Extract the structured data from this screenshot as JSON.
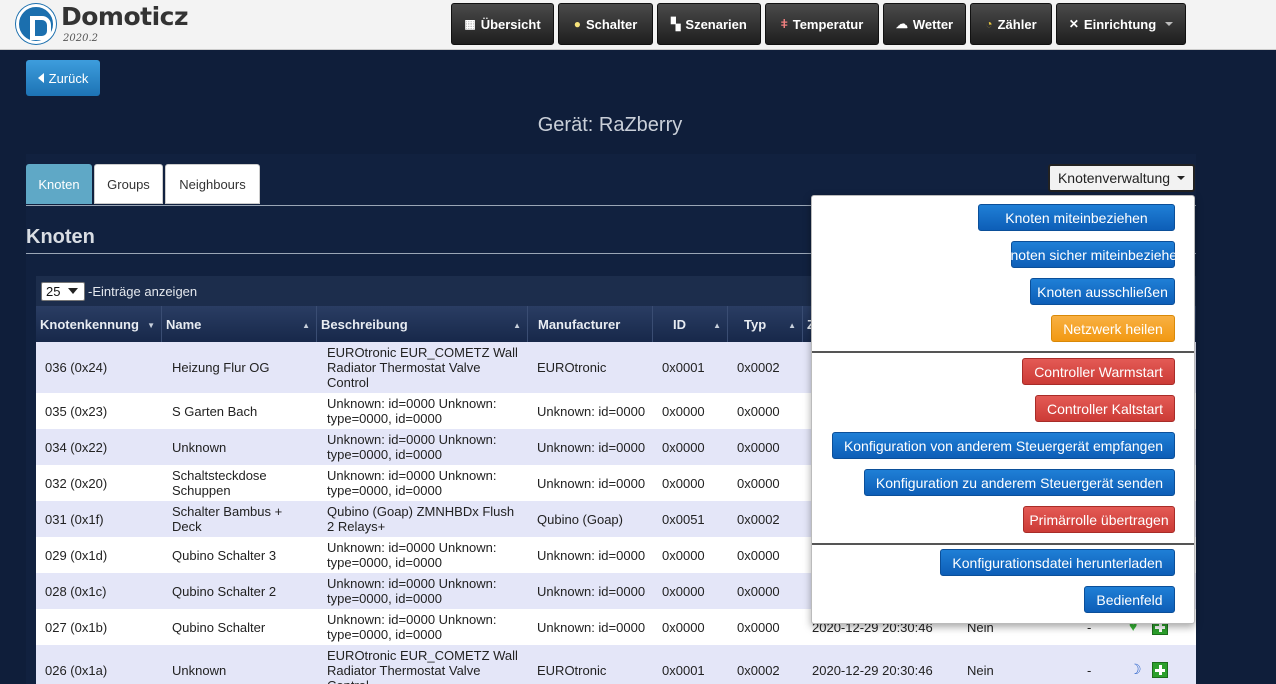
{
  "app": {
    "brand": "Domoticz",
    "version": "2020.2"
  },
  "nav": [
    {
      "label": "Übersicht",
      "icon": "dashboard-icon"
    },
    {
      "label": "Schalter",
      "icon": "lightbulb-icon"
    },
    {
      "label": "Szenarien",
      "icon": "scenes-icon"
    },
    {
      "label": "Temperatur",
      "icon": "thermometer-icon"
    },
    {
      "label": "Wetter",
      "icon": "weather-icon"
    },
    {
      "label": "Zähler",
      "icon": "meter-icon"
    },
    {
      "label": "Einrichtung",
      "icon": "tools-icon"
    }
  ],
  "back_label": "Zurück",
  "page_title": "Gerät: RaZberry",
  "tabs": [
    {
      "label": "Knoten"
    },
    {
      "label": "Groups"
    },
    {
      "label": "Neighbours"
    }
  ],
  "node_menu": {
    "label": "Knotenverwaltung",
    "items": [
      {
        "label": "Knoten miteinbeziehen",
        "color": "#1f7fd6"
      },
      {
        "label": "Knoten sicher miteinbeziehen",
        "color": "#1f7fd6"
      },
      {
        "label": "Knoten ausschließen",
        "color": "#1f7fd6"
      },
      {
        "label": "Netzwerk heilen",
        "color": "#f5a623"
      },
      {
        "label": "Controller Warmstart",
        "color": "#d9534f"
      },
      {
        "label": "Controller Kaltstart",
        "color": "#d9534f"
      },
      {
        "label": "Konfiguration von anderem Steuergerät empfangen",
        "color": "#1f7fd6"
      },
      {
        "label": "Konfiguration zu anderem Steuergerät senden",
        "color": "#1f7fd6"
      },
      {
        "label": "Primärrolle übertragen",
        "color": "#d9534f"
      },
      {
        "label": "Konfigurationsdatei herunterladen",
        "color": "#1f7fd6"
      },
      {
        "label": "Bedienfeld",
        "color": "#1f7fd6"
      }
    ]
  },
  "section_title": "Knoten",
  "page_length": {
    "value": "25",
    "label": "-Einträge anzeigen"
  },
  "columns": [
    "Knotenkennung",
    "Name",
    "Beschreibung",
    "Manufacturer",
    "ID",
    "Typ",
    "Z"
  ],
  "rows": [
    {
      "node": "036 (0x24)",
      "name": "Heizung Flur OG",
      "desc": "EUROtronic EUR_COMETZ Wall Radiator Thermostat Valve Control",
      "mfr": "EUROtronic",
      "id": "0x0001",
      "type": "0x0002",
      "time": "",
      "sec": "",
      "dash": ""
    },
    {
      "node": "035 (0x23)",
      "name": "S Garten Bach",
      "desc": "Unknown: id=0000 Unknown: type=0000, id=0000",
      "mfr": "Unknown: id=0000",
      "id": "0x0000",
      "type": "0x0000",
      "time": "",
      "sec": "",
      "dash": ""
    },
    {
      "node": "034 (0x22)",
      "name": "Unknown",
      "desc": "Unknown: id=0000 Unknown: type=0000, id=0000",
      "mfr": "Unknown: id=0000",
      "id": "0x0000",
      "type": "0x0000",
      "time": "",
      "sec": "",
      "dash": ""
    },
    {
      "node": "032 (0x20)",
      "name": "Schaltsteckdose Schuppen",
      "desc": "Unknown: id=0000 Unknown: type=0000, id=0000",
      "mfr": "Unknown: id=0000",
      "id": "0x0000",
      "type": "0x0000",
      "time": "",
      "sec": "",
      "dash": ""
    },
    {
      "node": "031 (0x1f)",
      "name": "Schalter Bambus + Deck",
      "desc": "Qubino (Goap) ZMNHBDx Flush 2 Relays+",
      "mfr": "Qubino (Goap)",
      "id": "0x0051",
      "type": "0x0002",
      "time": "",
      "sec": "",
      "dash": ""
    },
    {
      "node": "029 (0x1d)",
      "name": "Qubino Schalter 3",
      "desc": "Unknown: id=0000 Unknown: type=0000, id=0000",
      "mfr": "Unknown: id=0000",
      "id": "0x0000",
      "type": "0x0000",
      "time": "",
      "sec": "",
      "dash": ""
    },
    {
      "node": "028 (0x1c)",
      "name": "Qubino Schalter 2",
      "desc": "Unknown: id=0000 Unknown: type=0000, id=0000",
      "mfr": "Unknown: id=0000",
      "id": "0x0000",
      "type": "0x0000",
      "time": "",
      "sec": "",
      "dash": ""
    },
    {
      "node": "027 (0x1b)",
      "name": "Qubino Schalter",
      "desc": "Unknown: id=0000 Unknown: type=0000, id=0000",
      "mfr": "Unknown: id=0000",
      "id": "0x0000",
      "type": "0x0000",
      "time": "2020-12-29 20:30:46",
      "sec": "Nein",
      "dash": "-"
    },
    {
      "node": "026 (0x1a)",
      "name": "Unknown",
      "desc": "EUROtronic EUR_COMETZ Wall Radiator Thermostat Valve Control",
      "mfr": "EUROtronic",
      "id": "0x0001",
      "type": "0x0002",
      "time": "2020-12-29 20:30:46",
      "sec": "Nein",
      "dash": "-"
    }
  ]
}
